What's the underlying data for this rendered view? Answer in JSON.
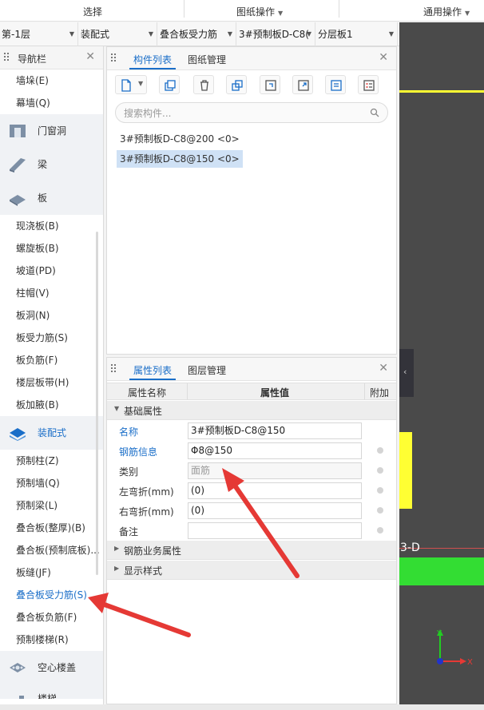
{
  "ribbon": {
    "select_label": "选择",
    "drawing_ops_label": "图纸操作",
    "common_ops_label": "通用操作"
  },
  "selectors": [
    {
      "value": "第-1层"
    },
    {
      "value": "装配式"
    },
    {
      "value": "叠合板受力筋"
    },
    {
      "value": "3#预制板D-C8("
    },
    {
      "value": "分层板1"
    }
  ],
  "nav": {
    "title": "导航栏",
    "items_top": [
      "墙垛(E)",
      "幕墙(Q)"
    ],
    "categories": {
      "door_window": "门窗洞",
      "beam": "梁",
      "slab": "板",
      "prefab": "装配式",
      "hollow_floor": "空心楼盖",
      "stairs": "楼梯"
    },
    "slab_items": [
      "现浇板(B)",
      "螺旋板(B)",
      "坡道(PD)",
      "柱帽(V)",
      "板洞(N)",
      "板受力筋(S)",
      "板负筋(F)",
      "楼层板带(H)",
      "板加腋(B)"
    ],
    "prefab_items": [
      "预制柱(Z)",
      "预制墙(Q)",
      "预制梁(L)",
      "叠合板(整厚)(B)",
      "叠合板(预制底板)...",
      "板缝(JF)",
      "叠合板受力筋(S)",
      "叠合板负筋(F)",
      "预制楼梯(R)"
    ],
    "active_item": "叠合板受力筋(S)"
  },
  "component_panel": {
    "tabs": [
      "构件列表",
      "图纸管理"
    ],
    "search_placeholder": "搜索构件...",
    "components": [
      "3#预制板D-C8@200 <0>",
      "3#预制板D-C8@150 <0>"
    ],
    "selected_index": 1
  },
  "property_panel": {
    "tabs": [
      "属性列表",
      "图层管理"
    ],
    "headers": {
      "name": "属性名称",
      "value": "属性值",
      "extra": "附加"
    },
    "group_basic": "基础属性",
    "rows": [
      {
        "name": "名称",
        "value": "3#预制板D-C8@150"
      },
      {
        "name": "钢筋信息",
        "value": "Φ8@150"
      },
      {
        "name": "类别",
        "value": "面筋"
      },
      {
        "name": "左弯折(mm)",
        "value": "(0)"
      },
      {
        "name": "右弯折(mm)",
        "value": "(0)"
      },
      {
        "name": "备注",
        "value": ""
      }
    ],
    "group_rebar_business": "钢筋业务属性",
    "group_display": "显示样式"
  },
  "canvas": {
    "label": "3-D",
    "axis_y": "Y",
    "axis_x": "X"
  },
  "colors": {
    "accent": "#1a6ec8",
    "canvas_bg": "#4a4a4a",
    "yellow": "#ffff33",
    "green": "#33dd33",
    "annotation_red": "#e53935"
  }
}
